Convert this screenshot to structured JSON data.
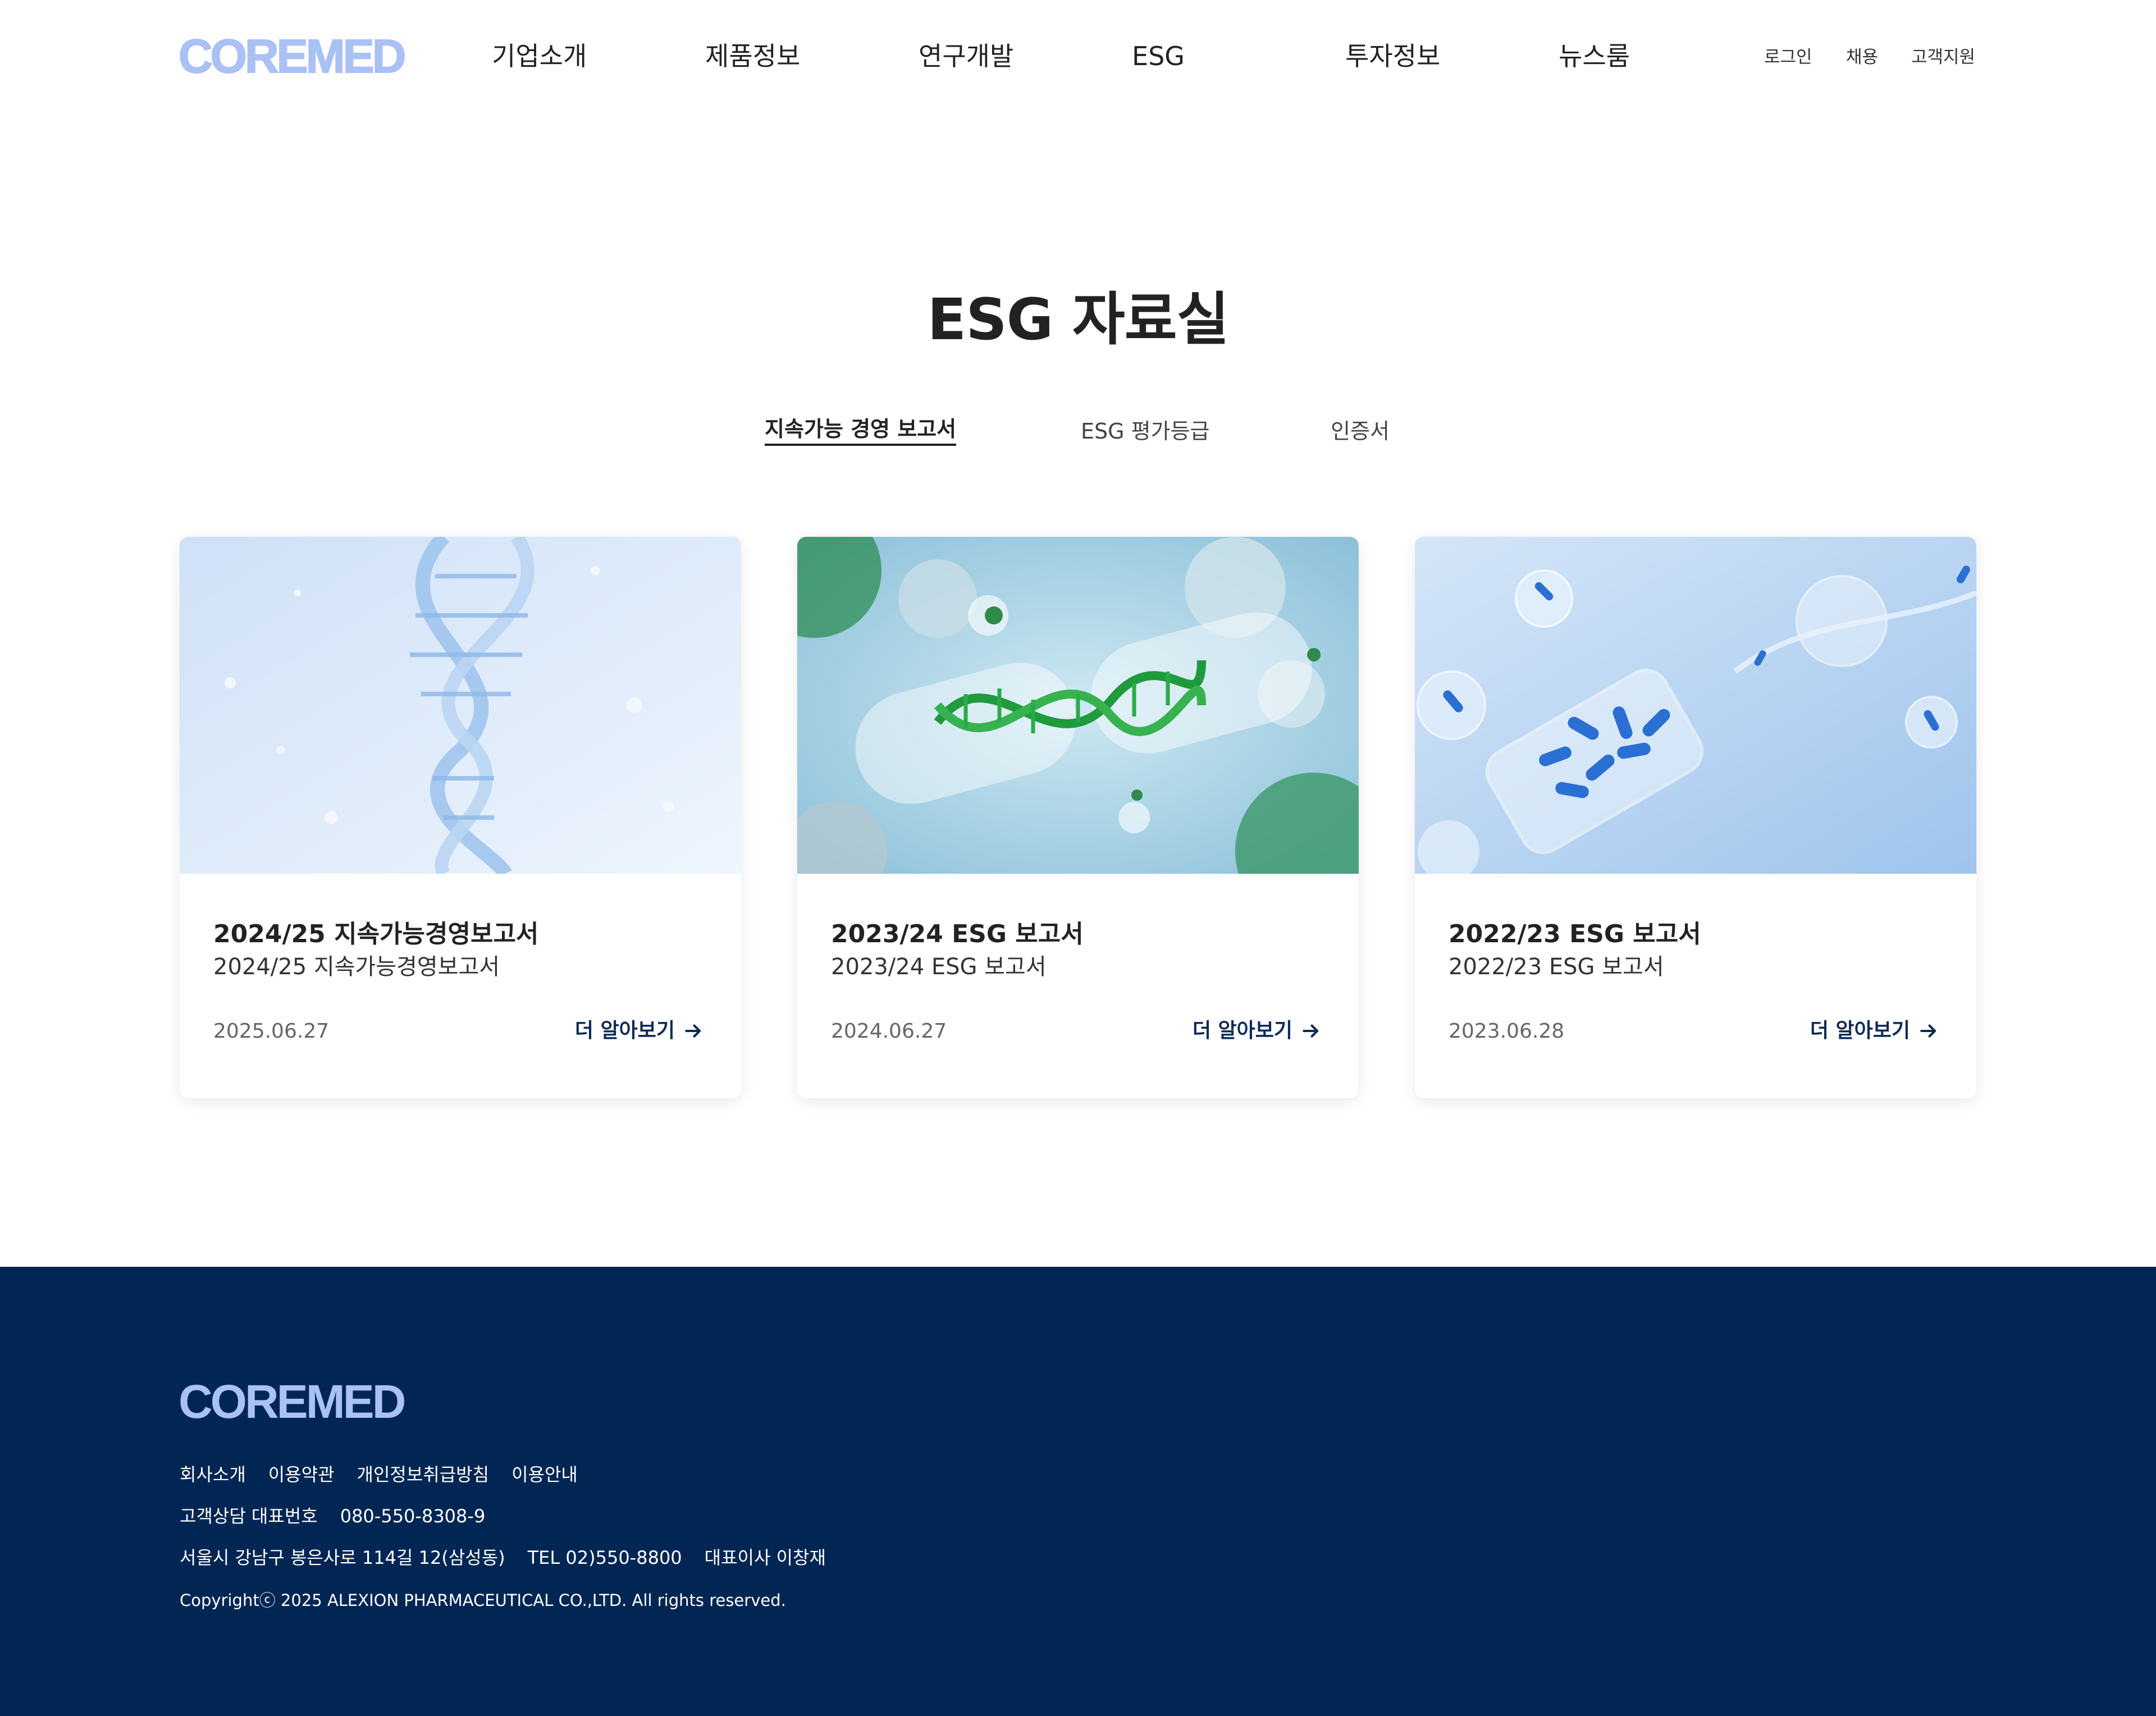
{
  "header": {
    "logo": "COREMED",
    "nav": [
      "기업소개",
      "제품정보",
      "연구개발",
      "ESG",
      "투자정보",
      "뉴스룸"
    ],
    "util": [
      "로그인",
      "채용",
      "고객지원"
    ]
  },
  "main": {
    "title": "ESG 자료실",
    "tabs": [
      {
        "label": "지속가능 경영 보고서",
        "active": true
      },
      {
        "label": "ESG 평가등급",
        "active": false
      },
      {
        "label": "인증서",
        "active": false
      }
    ],
    "cards": [
      {
        "title": "2024/25 지속가능경영보고서",
        "subtitle": "2024/25 지속가능경영보고서",
        "date": "2025.06.27",
        "more": "더 알아보기"
      },
      {
        "title": "2023/24 ESG 보고서",
        "subtitle": "2023/24 ESG 보고서",
        "date": "2024.06.27",
        "more": "더 알아보기"
      },
      {
        "title": "2022/23 ESG 보고서",
        "subtitle": "2022/23 ESG 보고서",
        "date": "2023.06.28",
        "more": "더 알아보기"
      }
    ]
  },
  "footer": {
    "logo": "COREMED",
    "links": [
      "회사소개",
      "이용약관",
      "개인정보취급방침",
      "이용안내"
    ],
    "contact_label": "고객상담 대표번호",
    "contact_number": "080-550-8308-9",
    "address": "서울시 강남구 봉은사로 114길 12(삼성동)",
    "tel": "TEL 02)550-8800",
    "ceo": "대표이사 이창재",
    "copyright": "Copyrightⓒ 2025 ALEXION PHARMACEUTICAL CO.,LTD. All rights reserved."
  },
  "colors": {
    "logo": "#a9c1f5",
    "footer_bg": "#012654",
    "more_link": "#0f2a56"
  }
}
